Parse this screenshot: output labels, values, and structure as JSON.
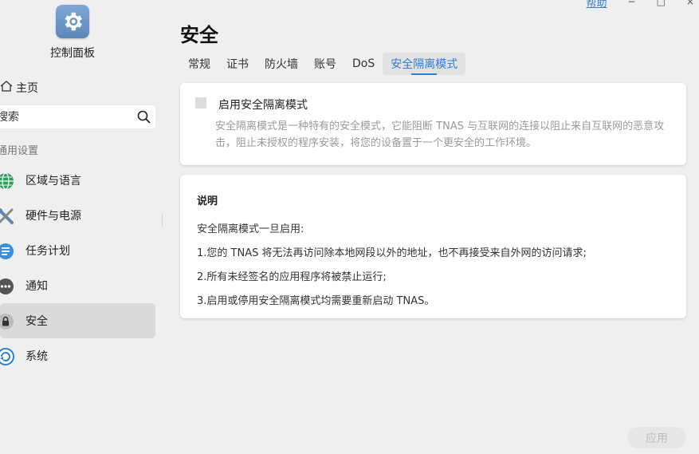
{
  "window": {
    "help_label": "帮助",
    "minimize": "−",
    "maximize": "□",
    "close": "×"
  },
  "sidebar": {
    "app_title": "控制面板",
    "home_label": "主页",
    "search_placeholder": "搜索",
    "section_label": "通用设置",
    "items": [
      {
        "label": "区域与语言",
        "icon": "globe-icon",
        "color": "#2e9e5b"
      },
      {
        "label": "硬件与电源",
        "icon": "tools-icon",
        "color": "#5b86b8"
      },
      {
        "label": "任务计划",
        "icon": "task-list-icon",
        "color": "#3b8fd9"
      },
      {
        "label": "通知",
        "icon": "chat-bubble-icon",
        "color": "#555555"
      },
      {
        "label": "安全",
        "icon": "lock-icon",
        "color": "#444444",
        "active": true
      },
      {
        "label": "系统",
        "icon": "system-refresh-icon",
        "color": "#2d7fd3"
      }
    ]
  },
  "main": {
    "title": "安全",
    "tabs": [
      {
        "label": "常规"
      },
      {
        "label": "证书"
      },
      {
        "label": "防火墙"
      },
      {
        "label": "账号"
      },
      {
        "label": "DoS"
      },
      {
        "label": "安全隔离模式",
        "active": true
      }
    ],
    "option": {
      "label": "启用安全隔离模式",
      "checked": false,
      "description": "安全隔离模式是一种特有的安全模式，它能阻断 TNAS 与互联网的连接以阻止来自互联网的恶意攻击，阻止未授权的程序安装，将您的设备置于一个更安全的工作环境。"
    },
    "notes": {
      "heading": "说明",
      "intro": "安全隔离模式一旦启用:",
      "items": [
        "1.您的 TNAS 将无法再访问除本地网段以外的地址，也不再接受来自外网的访问请求;",
        "2.所有未经签名的应用程序将被禁止运行;",
        "3.启用或停用安全隔离模式均需要重新启动 TNAS。"
      ]
    },
    "apply_label": "应用"
  },
  "colors": {
    "accent": "#2d7fd3",
    "background": "#efefef",
    "active_item": "#dadada"
  }
}
